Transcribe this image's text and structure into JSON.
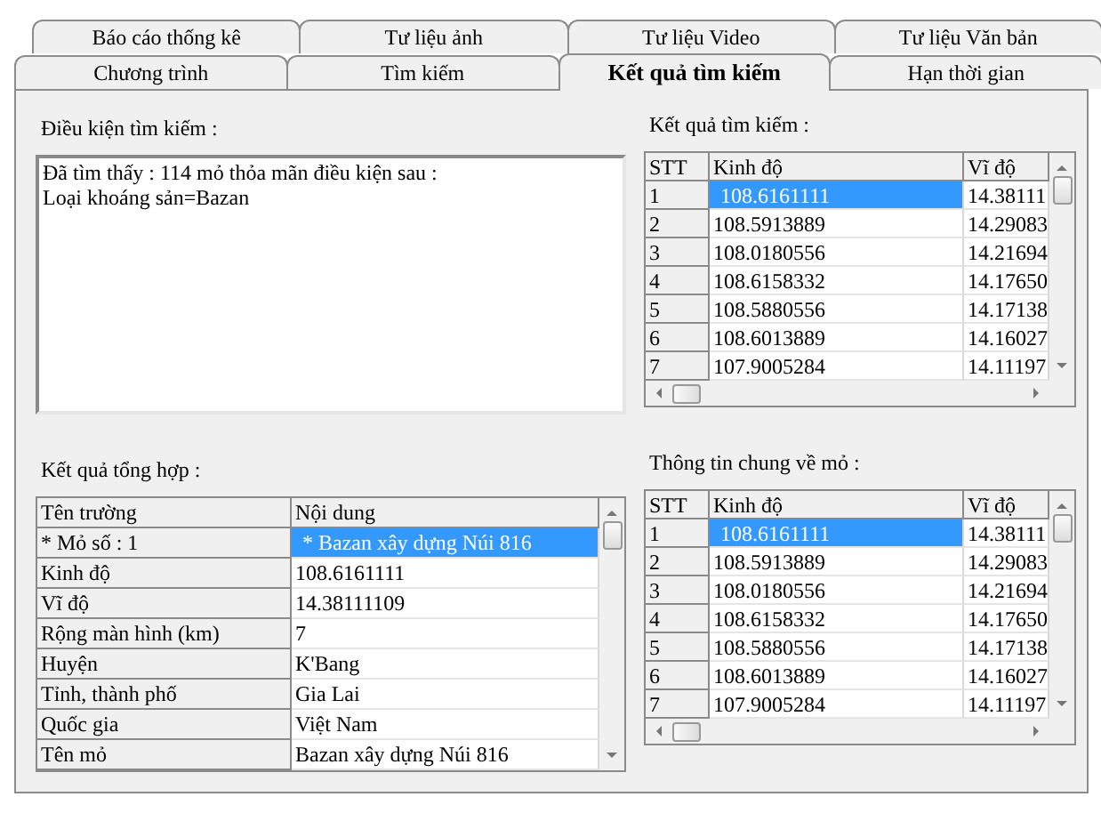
{
  "tab_rows": [
    [
      {
        "label": "Báo cáo thống kê",
        "selected": false
      },
      {
        "label": "Tư liệu ảnh",
        "selected": false
      },
      {
        "label": "Tư liệu Video",
        "selected": false
      },
      {
        "label": "Tư liệu Văn bản",
        "selected": false
      }
    ],
    [
      {
        "label": "Chương trình",
        "selected": false
      },
      {
        "label": "Tìm kiếm",
        "selected": false
      },
      {
        "label": "Kết quả tìm kiếm",
        "selected": true
      },
      {
        "label": "Hạn thời gian",
        "selected": false
      }
    ]
  ],
  "search_conditions": {
    "label": "Điều kiện tìm kiếm :",
    "lines": [
      "Đã tìm thấy : 114 mỏ thỏa mãn điều kiện sau :",
      "Loại khoáng sản=Bazan"
    ]
  },
  "search_results": {
    "label": "Kết quả tìm kiếm :",
    "columns": [
      "STT",
      "Kinh độ",
      "Vĩ độ"
    ],
    "rows": [
      {
        "cells": [
          "1",
          "108.6161111",
          "14.38111"
        ],
        "selected": true
      },
      {
        "cells": [
          "2",
          "108.5913889",
          "14.29083"
        ],
        "selected": false
      },
      {
        "cells": [
          "3",
          "108.0180556",
          "14.21694"
        ],
        "selected": false
      },
      {
        "cells": [
          "4",
          "108.6158332",
          "14.17650"
        ],
        "selected": false
      },
      {
        "cells": [
          "5",
          "108.5880556",
          "14.17138"
        ],
        "selected": false
      },
      {
        "cells": [
          "6",
          "108.6013889",
          "14.16027"
        ],
        "selected": false
      },
      {
        "cells": [
          "7",
          "107.9005284",
          "14.11197"
        ],
        "selected": false
      }
    ]
  },
  "summary": {
    "label": "Kết quả tổng hợp :",
    "columns": [
      "Tên trường",
      "Nội dung"
    ],
    "rows": [
      {
        "cells": [
          "*  Mỏ số : 1",
          "* Bazan xây dựng Núi 816"
        ],
        "selected": true
      },
      {
        "cells": [
          "Kinh độ",
          "108.6161111"
        ],
        "selected": false
      },
      {
        "cells": [
          "Vĩ độ",
          "14.38111109"
        ],
        "selected": false
      },
      {
        "cells": [
          "Rộng màn hình (km)",
          "7"
        ],
        "selected": false
      },
      {
        "cells": [
          "Huyện",
          "K'Bang"
        ],
        "selected": false
      },
      {
        "cells": [
          "Tỉnh, thành phố",
          "Gia Lai"
        ],
        "selected": false
      },
      {
        "cells": [
          "Quốc gia",
          "Việt Nam"
        ],
        "selected": false
      },
      {
        "cells": [
          "Tên mỏ",
          "Bazan xây dựng Núi 816"
        ],
        "selected": false
      }
    ]
  },
  "mine_info": {
    "label": "Thông tin chung về mỏ :",
    "columns": [
      "STT",
      "Kinh độ",
      "Vĩ độ"
    ],
    "rows": [
      {
        "cells": [
          "1",
          "108.6161111",
          "14.38111"
        ],
        "selected": true
      },
      {
        "cells": [
          "2",
          "108.5913889",
          "14.29083"
        ],
        "selected": false
      },
      {
        "cells": [
          "3",
          "108.0180556",
          "14.21694"
        ],
        "selected": false
      },
      {
        "cells": [
          "4",
          "108.6158332",
          "14.17650"
        ],
        "selected": false
      },
      {
        "cells": [
          "5",
          "108.5880556",
          "14.17138"
        ],
        "selected": false
      },
      {
        "cells": [
          "6",
          "108.6013889",
          "14.16027"
        ],
        "selected": false
      },
      {
        "cells": [
          "7",
          "107.9005284",
          "14.11197"
        ],
        "selected": false
      }
    ]
  }
}
